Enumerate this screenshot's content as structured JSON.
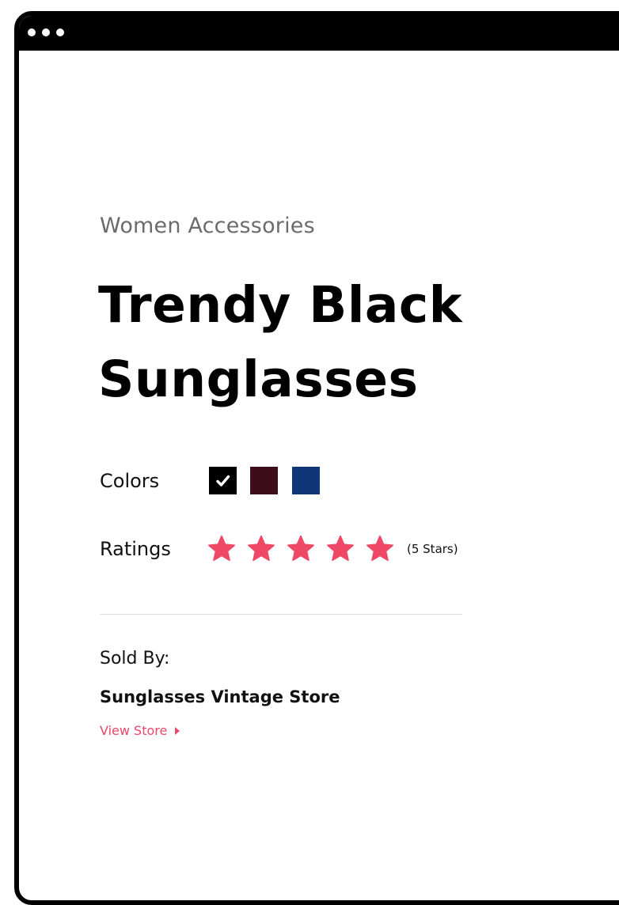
{
  "window": {
    "frame_color": "#000000",
    "controls": [
      "dot",
      "dot",
      "dot"
    ]
  },
  "product": {
    "category": "Women Accessories",
    "title": "Trendy Black Sunglasses"
  },
  "colors": {
    "label": "Colors",
    "options": [
      {
        "name": "black",
        "hex": "#000000",
        "selected": true,
        "icon": "checkmark-icon"
      },
      {
        "name": "maroon",
        "hex": "#3e0d1b",
        "selected": false
      },
      {
        "name": "navy",
        "hex": "#0e3679",
        "selected": false
      }
    ]
  },
  "ratings": {
    "label": "Ratings",
    "value": 5,
    "max": 5,
    "count_text": "(5 Stars)",
    "star_color": "#ef4866",
    "icon": "star-icon"
  },
  "seller": {
    "sold_by_label": "Sold By:",
    "store_name": "Sunglasses Vintage Store",
    "view_store_label": "View Store",
    "link_color": "#e8476a",
    "link_icon": "caret-right-icon"
  }
}
